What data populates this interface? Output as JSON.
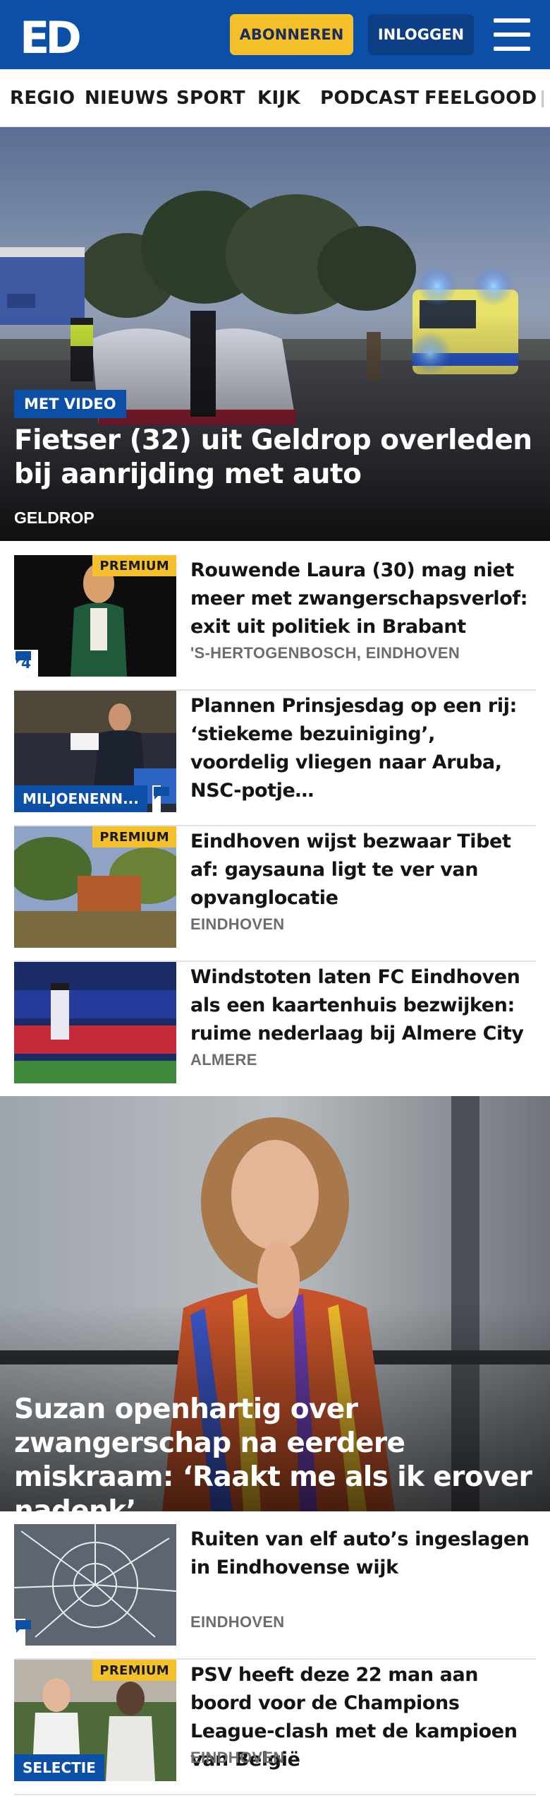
{
  "header": {
    "logo_text": "ED",
    "subscribe_label": "ABONNEREN",
    "login_label": "INLOGGEN"
  },
  "nav": {
    "items": [
      "REGIO",
      "NIEUWS",
      "SPORT",
      "KIJK",
      "PODCAST",
      "FEELGOOD"
    ]
  },
  "hero": {
    "badge": "MET VIDEO",
    "title": "Fietser (32) uit Geldrop overleden bij aanrijding met auto",
    "location": "GELDROP"
  },
  "articles": [
    {
      "title": "Rouwende Laura (30) mag niet meer met zwangerschapsverlof: exit uit politiek in Brabant",
      "location": "'S-HERTOGENBOSCH, EINDHOVEN",
      "premium": "PREMIUM",
      "comments": "4"
    },
    {
      "title": "Plannen Prinsjesdag op een rij: ‘stiekeme bezuiniging’, voordelig vliegen naar Aruba, NSC-potje…",
      "tag": "MILJOENENN..."
    },
    {
      "title": "Eindhoven wijst bezwaar Tibet af: gaysauna ligt te ver van opvanglocatie",
      "location": "EINDHOVEN",
      "premium": "PREMIUM"
    },
    {
      "title": "Windstoten laten FC Eindhoven als een kaartenhuis bezwijken: ruime nederlaag bij Almere City",
      "location": "ALMERE"
    }
  ],
  "feature": {
    "title": "Suzan openhartig over zwangerschap na eerdere miskraam: ‘Raakt me als ik erover nadenk’"
  },
  "articles2": [
    {
      "title": "Ruiten van elf auto’s ingeslagen in Eindhovense wijk",
      "location": "EINDHOVEN"
    },
    {
      "title": "PSV heeft deze 22 man aan boord voor de Champions League-clash met de kampioen van België",
      "location": "EINDHOVEN",
      "premium": "PREMIUM",
      "tag": "SELECTIE"
    }
  ],
  "colors": {
    "brand_blue": "#0b4fa6",
    "premium_yellow": "#f5c12b",
    "login_blue": "#0c3f85"
  },
  "icons": {
    "menu": "hamburger-icon",
    "comment": "comment-bubble-icon"
  }
}
